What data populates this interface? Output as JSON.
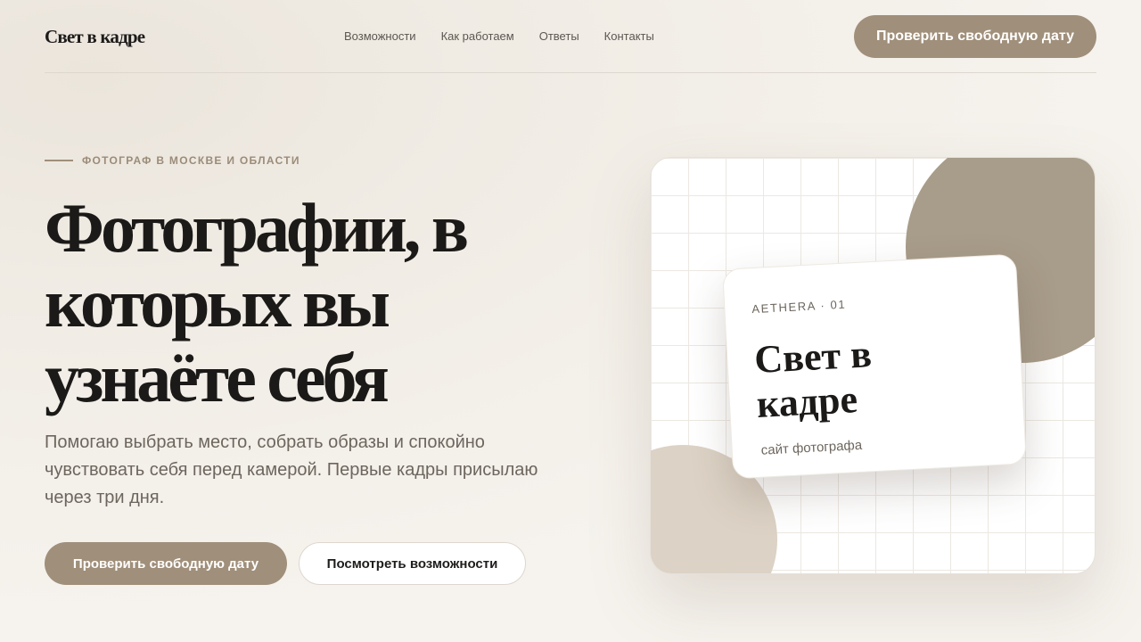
{
  "header": {
    "logo": "Свет в кадре",
    "nav": [
      "Возможности",
      "Как работаем",
      "Ответы",
      "Контакты"
    ],
    "cta_label": "Проверить свободную дату"
  },
  "hero": {
    "eyebrow": "ФОТОГРАФ В МОСКВЕ И ОБЛАСТИ",
    "title": "Фотографии, в которых вы узнаёте себя",
    "text": "Помогаю выбрать место, собрать образы и спокойно чувствовать себя перед камерой. Первые кадры присылаю через три дня.",
    "primary_cta": "Проверить свободную дату",
    "secondary_cta": "Посмотреть возможности"
  },
  "visual_card": {
    "kicker": "AETHERA · 01",
    "title": "Свет в кадре",
    "subtitle": "сайт фотографа"
  },
  "colors": {
    "accent": "#a08f7a",
    "blob_dark": "#a89c8a",
    "blob_light": "#dcd2c5",
    "background": "#f6f3ee",
    "text": "#1b1a18"
  }
}
